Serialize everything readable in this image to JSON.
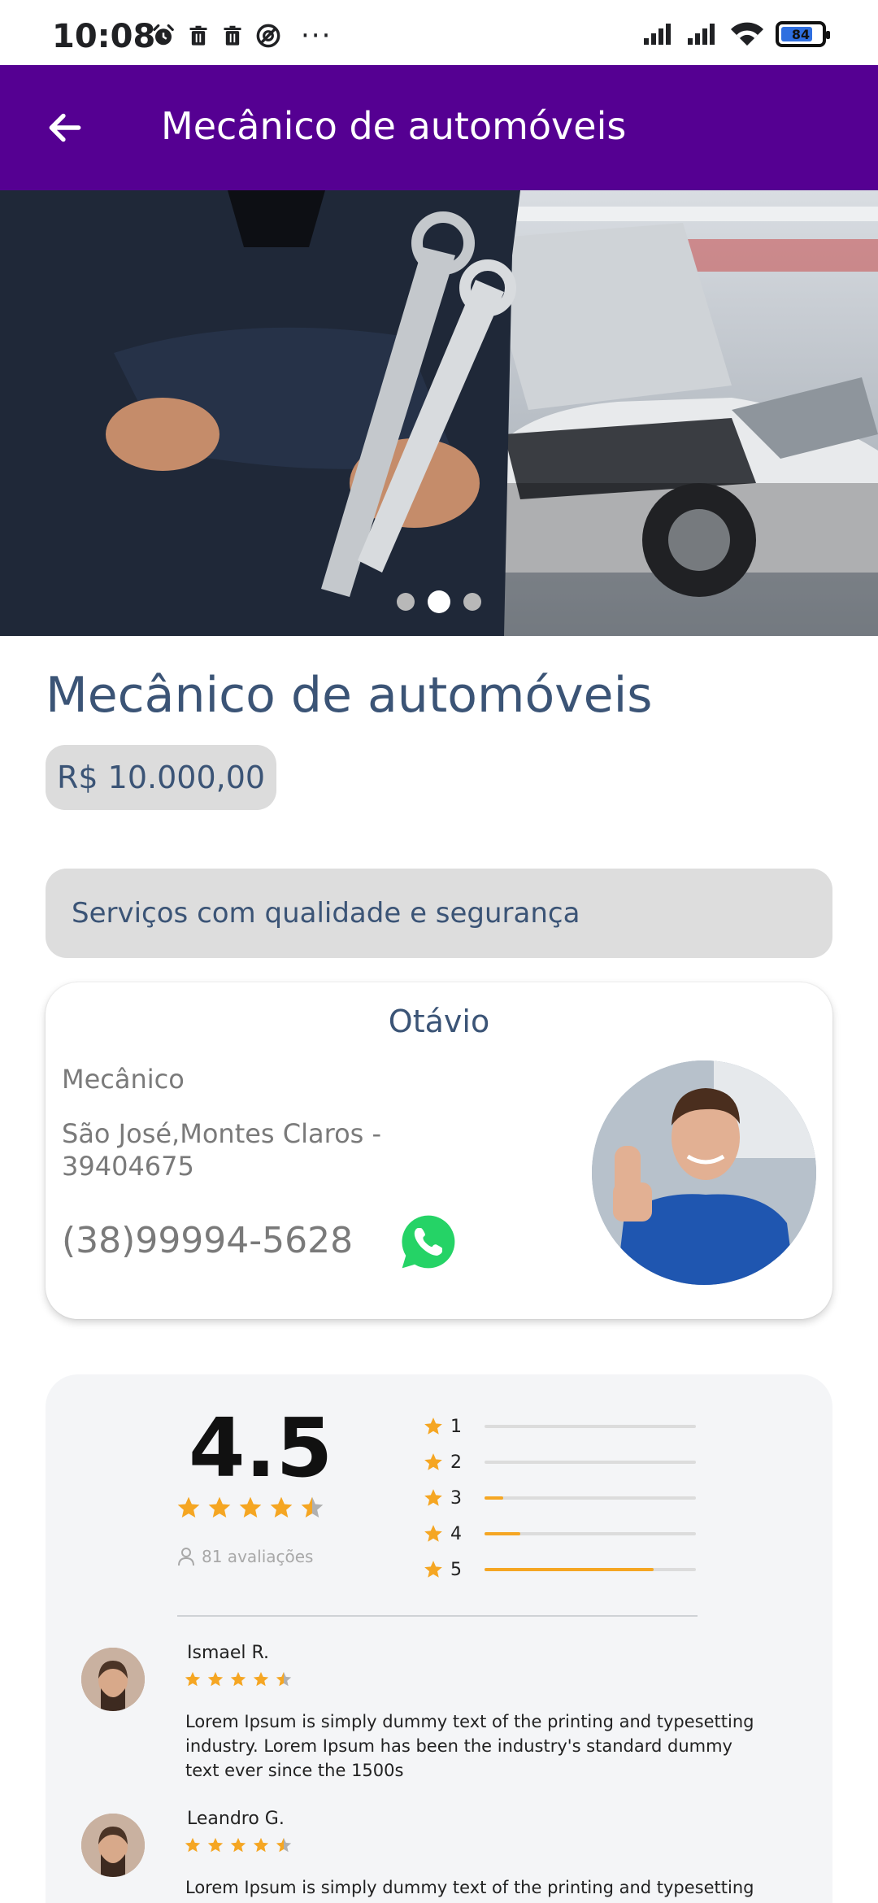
{
  "status_bar": {
    "time": "10:08",
    "battery": "84",
    "left_icons": [
      "alarm-icon",
      "trash-icon",
      "trash-icon",
      "do-not-disturb-icon"
    ],
    "more": "···"
  },
  "app_bar": {
    "title": "Mecânico de automóveis",
    "back_icon": "arrow-left-icon",
    "color": "#550092"
  },
  "carousel": {
    "page_count": 3,
    "active_index": 1
  },
  "product": {
    "title": "Mecânico de automóveis",
    "price": "R$ 10.000,00",
    "tagline": "Serviços com qualidade e segurança"
  },
  "provider": {
    "name": "Otávio",
    "role": "Mecânico",
    "address": "São José,Montes Claros - 39404675",
    "phone": "(38)99994-5628",
    "contact_icon": "whatsapp-icon"
  },
  "ratings": {
    "average": "4.5",
    "average_stars": 4.5,
    "count_label": "81 avaliações",
    "distribution": [
      {
        "label": "1",
        "fraction": 0.0
      },
      {
        "label": "2",
        "fraction": 0.0
      },
      {
        "label": "3",
        "fraction": 0.09
      },
      {
        "label": "4",
        "fraction": 0.17
      },
      {
        "label": "5",
        "fraction": 0.8
      }
    ],
    "accent": "#f5a623"
  },
  "reviews": [
    {
      "name": "Ismael R.",
      "stars": 4.5,
      "text": "Lorem Ipsum is simply dummy text of the printing and typesetting industry. Lorem Ipsum has been the industry's standard dummy text ever since the 1500s"
    },
    {
      "name": "Leandro G.",
      "stars": 4.5,
      "text": "Lorem Ipsum is simply dummy text of the printing and typesetting"
    }
  ]
}
